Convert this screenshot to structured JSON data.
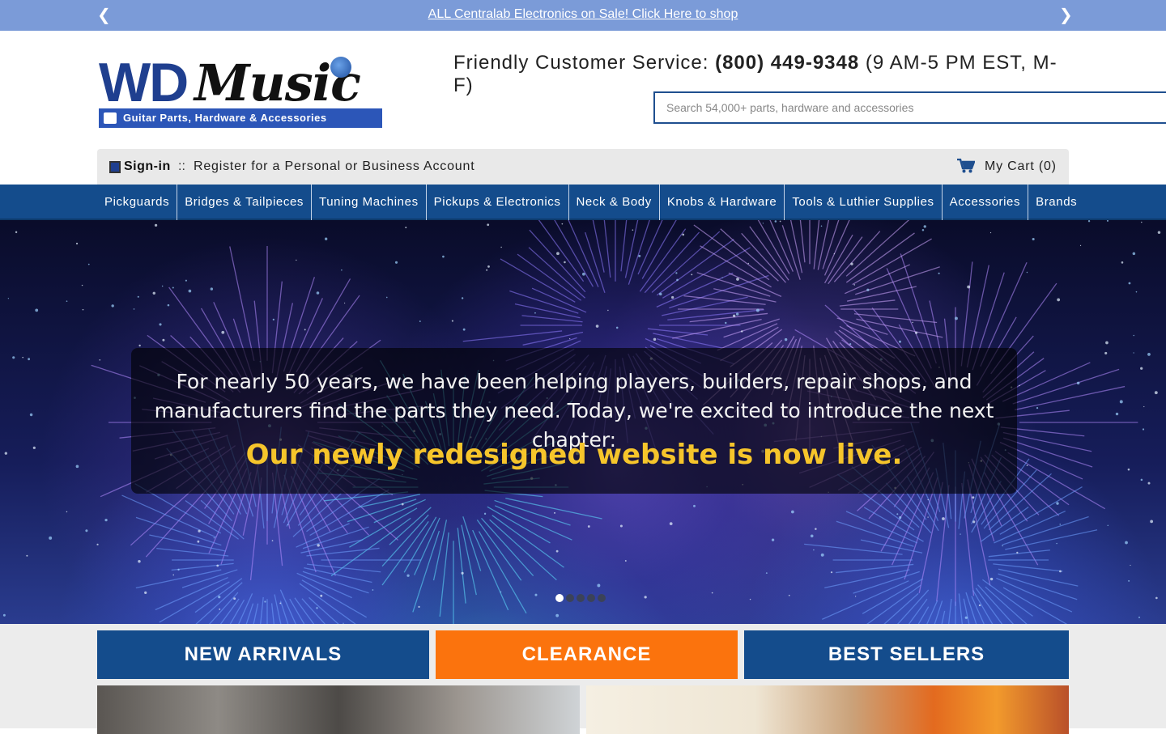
{
  "announcement": {
    "text": "ALL Centralab Electronics on Sale! Click Here to shop",
    "prev": "❮",
    "next": "❯"
  },
  "logo": {
    "wd": "WD",
    "music": "Music",
    "tagline": "Guitar Parts, Hardware & Accessories"
  },
  "contact": {
    "label": "Friendly Customer Service: ",
    "phone": "(800) 449-9348",
    "hours": " (9 AM-5 PM EST, M-F)"
  },
  "search": {
    "placeholder": "Search 54,000+ parts, hardware and accessories"
  },
  "account": {
    "signin": "Sign-in",
    "separator": "::",
    "register": "Register for a Personal or Business Account",
    "cart": "My Cart (0)"
  },
  "nav": {
    "items": [
      "Pickguards",
      "Bridges & Tailpieces",
      "Tuning Machines",
      "Pickups & Electronics",
      "Neck & Body",
      "Knobs & Hardware",
      "Tools & Luthier Supplies",
      "Accessories",
      "Brands"
    ]
  },
  "hero": {
    "text": "For nearly 50 years, we have been helping players, builders, repair shops, and manufacturers find the parts they need. Today, we're excited to introduce the next chapter:",
    "headline": "Our newly redesigned website is now live.",
    "slide_count": 5,
    "active_slide": 1
  },
  "tiles": {
    "new": "NEW ARRIVALS",
    "clearance": "CLEARANCE",
    "best": "BEST SELLERS"
  },
  "colors": {
    "announcement_bg": "#7b9bd8",
    "nav_bg": "#144c8c",
    "clearance_bg": "#fb730d",
    "headline": "#f6c52b"
  }
}
